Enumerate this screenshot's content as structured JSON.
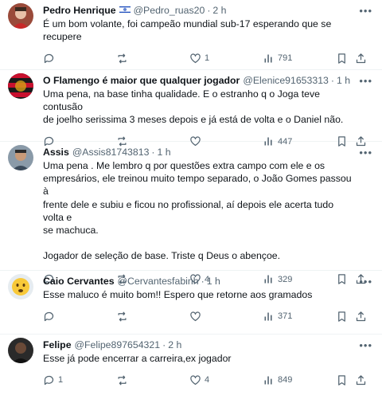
{
  "posts": [
    {
      "name": "Pedro Henrique",
      "handle": "@Pedro_ruas20",
      "time": "2 h",
      "text": "É um bom volante, foi campeão mundial sub-17 esperando que se\nrecupere",
      "reply_count": "",
      "repost_count": "",
      "like_count": "1",
      "view_count": "791",
      "flag_icon": "israel-flag-icon"
    },
    {
      "name": "O Flamengo é maior que qualquer jogador",
      "handle": "@Elenice91653313",
      "time": "1 h",
      "text": "Uma pena, na base tinha qualidade. E o estranho q o Joga teve contusão\nde joelho serissima 3 meses depois e já está de volta e o Daniel não.",
      "reply_count": "",
      "repost_count": "",
      "like_count": "",
      "view_count": "447"
    },
    {
      "name": "Assis",
      "handle": "@Assis81743813",
      "time": "1 h",
      "text": "Uma pena . Me lembro q por questões extra campo com ele e os\nempresários, ele treinou muito tempo separado, o João Gomes passou à\nfrente dele e subiu e ficou no profissional, aí depois ele acerta tudo volta e\nse machuca.\n\nJogador de seleção de base. Triste q Deus o abençoe.",
      "reply_count": "",
      "repost_count": "",
      "like_count": "4",
      "view_count": "329"
    },
    {
      "name": "Caio Cervantes",
      "handle": "@Cervantesfabinh",
      "time": "1 h",
      "text": "Esse maluco é muito bom!! Espero que retorne aos gramados",
      "reply_count": "",
      "repost_count": "",
      "like_count": "",
      "view_count": "371"
    },
    {
      "name": "Felipe",
      "handle": "@Felipe897654321",
      "time": "2 h",
      "text": "Esse já pode encerrar a carreira,ex jogador",
      "reply_count": "1",
      "repost_count": "",
      "like_count": "4",
      "view_count": "849"
    }
  ],
  "icons": {
    "more": "more-icon",
    "reply": "reply-icon",
    "repost": "repost-icon",
    "like": "like-icon",
    "views": "views-icon",
    "bookmark": "bookmark-icon",
    "share": "share-icon"
  },
  "colors": {
    "text": "#0f1419",
    "secondary": "#536471",
    "divider": "#eff3f4"
  }
}
